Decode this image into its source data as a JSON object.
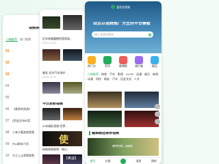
{
  "colors": {
    "brand": "#21ad5a",
    "rank_top": "#ff7a00"
  },
  "left": {
    "title": "视频排行",
    "tabs": [
      "小编推荐",
      "热门视频"
    ],
    "ranks": [
      "01",
      "02",
      "03",
      "04",
      "05",
      "06",
      "07",
      "08",
      "09",
      "10"
    ],
    "items": [
      "《曾家的男孩》",
      "[世纪]古诗对话",
      "二来卡看游戏视频",
      "Pilot剧本介绍",
      "大江上让视频视频"
    ]
  },
  "middle": {
    "captions": [
      "近年来最震撼的国家级...",
      "美发 北京汽车测评...",
      "20年精彩视频 世界...",
      "网络视频视频：每日..."
    ],
    "dates": [
      "2023-12-10",
      "2023-12-10",
      "2023-12-10"
    ],
    "section_title": "今日更新视频",
    "thumb_labels": [
      "使",
      "【奥迪】"
    ]
  },
  "right": {
    "brand_name": "爱奇艺视频",
    "header": "站点以视频推广为主的平台模板",
    "search_placeholder": "输入关键词搜索",
    "nav": [
      "热门分",
      "资讯",
      "微博报",
      "旅行者",
      "精品"
    ],
    "tags": [
      "小说推荐",
      "体育",
      "汽车",
      "影视",
      "VLOG",
      "动漫",
      "娱乐",
      "新闻",
      "动漫",
      "科技",
      "搞笑",
      "汽车",
      "历史文化",
      "人文"
    ],
    "section_title": "编辑精选推荐视频",
    "banner_text": "推荐热门视频",
    "bottom_nav": [
      "首页",
      "分类",
      "发布",
      "消息",
      "我的"
    ]
  }
}
